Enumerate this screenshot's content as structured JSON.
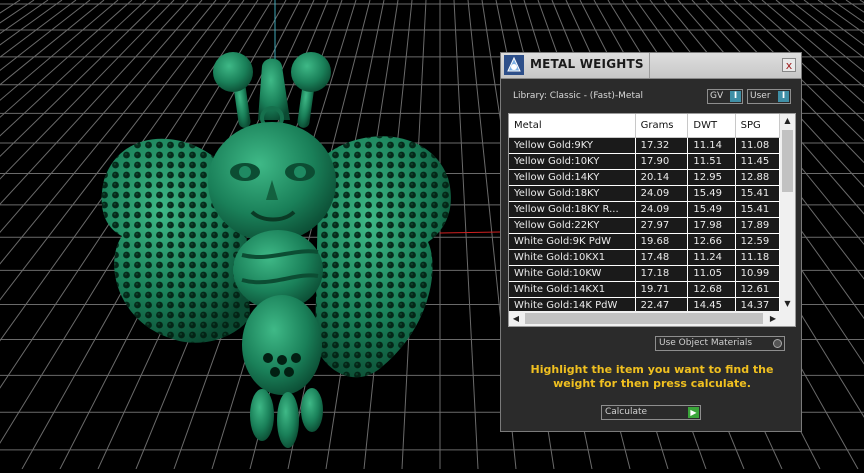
{
  "panel": {
    "title": "METAL WEIGHTS",
    "close_label": "x",
    "library_label": "Library: Classic - (Fast)-Metal",
    "gv_label": "GV",
    "user_label": "User",
    "toggle_glyph": "I",
    "use_object_materials_label": "Use Object Materials",
    "instruction": "Highlight the item you want to find the weight for then press calculate.",
    "calculate_label": "Calculate",
    "calculate_glyph": "▶",
    "accent_color": "#3f8fa6",
    "instruction_color": "#f0c020"
  },
  "table": {
    "columns": [
      "Metal",
      "Grams",
      "DWT",
      "SPG"
    ],
    "rows": [
      [
        "Yellow Gold:9KY",
        "17.32",
        "11.14",
        "11.08"
      ],
      [
        "Yellow Gold:10KY",
        "17.90",
        "11.51",
        "11.45"
      ],
      [
        "Yellow Gold:14KY",
        "20.14",
        "12.95",
        "12.88"
      ],
      [
        "Yellow Gold:18KY",
        "24.09",
        "15.49",
        "15.41"
      ],
      [
        "Yellow Gold:18KY R...",
        "24.09",
        "15.49",
        "15.41"
      ],
      [
        "Yellow Gold:22KY",
        "27.97",
        "17.98",
        "17.89"
      ],
      [
        "White Gold:9K PdW",
        "19.68",
        "12.66",
        "12.59"
      ],
      [
        "White Gold:10KX1",
        "17.48",
        "11.24",
        "11.18"
      ],
      [
        "White Gold:10KW",
        "17.18",
        "11.05",
        "10.99"
      ],
      [
        "White Gold:14KX1",
        "19.71",
        "12.68",
        "12.61"
      ],
      [
        "White Gold:14K PdW",
        "22.47",
        "14.45",
        "14.37"
      ]
    ],
    "scroll_up": "▲",
    "scroll_down": "▼",
    "scroll_left": "◀",
    "scroll_right": "▶"
  },
  "viewport": {
    "grid_color": "#6a6a6a",
    "model_color": "#1f8a62",
    "y_axis_color": "#3fa9b8",
    "x_axis_color": "#d02020"
  }
}
